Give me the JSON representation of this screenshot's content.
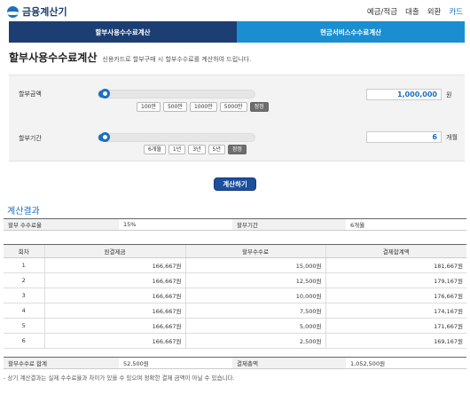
{
  "app": {
    "logo_text": "금융계산기"
  },
  "topnav": [
    {
      "label": "예금/적금",
      "active": false
    },
    {
      "label": "대출",
      "active": false
    },
    {
      "label": "외환",
      "active": false
    },
    {
      "label": "카드",
      "active": true
    }
  ],
  "tabs": [
    {
      "label": "할부사용수수료계산"
    },
    {
      "label": "현금서비스수수료계산"
    }
  ],
  "page": {
    "title": "할부사용수수료계산",
    "description": "신용카드로 할부구매 시 할부수수료를 계산하여 드립니다."
  },
  "form": {
    "amount": {
      "label": "할부금액",
      "value": "1,000,000",
      "unit": "원",
      "slider_fraction": 0.02,
      "buttons": [
        "100만",
        "500만",
        "1000만",
        "5000만",
        "정정"
      ]
    },
    "term": {
      "label": "할부기간",
      "value": "6",
      "unit": "개월",
      "slider_fraction": 0.04,
      "buttons": [
        "6개월",
        "1년",
        "3년",
        "5년",
        "정정"
      ]
    },
    "calc_button": "계산하기"
  },
  "result": {
    "title": "계산결과",
    "summary_top": {
      "rate_label": "할부 수수료율",
      "rate_value": "15%",
      "term_label": "할부기간",
      "term_value": "6개월"
    },
    "columns": [
      "회차",
      "원결제금",
      "할부수수료",
      "결제합계액"
    ],
    "rows": [
      [
        "1",
        "166,667원",
        "15,000원",
        "181,667원"
      ],
      [
        "2",
        "166,667원",
        "12,500원",
        "179,167원"
      ],
      [
        "3",
        "166,667원",
        "10,000원",
        "176,667원"
      ],
      [
        "4",
        "166,667원",
        "7,500원",
        "174,167원"
      ],
      [
        "5",
        "166,667원",
        "5,000원",
        "171,667원"
      ],
      [
        "6",
        "166,667원",
        "2,500원",
        "169,167원"
      ]
    ],
    "summary_bottom": {
      "fee_total_label": "할부수수료 합계",
      "fee_total_value": "52,500원",
      "pay_total_label": "결제총액",
      "pay_total_value": "1,052,500원"
    },
    "note": "- 상기 계산결과는 실제 수수료율과 차이가 있을 수 있으며 정확한 결제 금액이 아닐 수 있습니다."
  },
  "colors": {
    "brand_dark": "#1c3e73",
    "brand_light": "#1a8ed0",
    "accent": "#1b6fc1"
  }
}
